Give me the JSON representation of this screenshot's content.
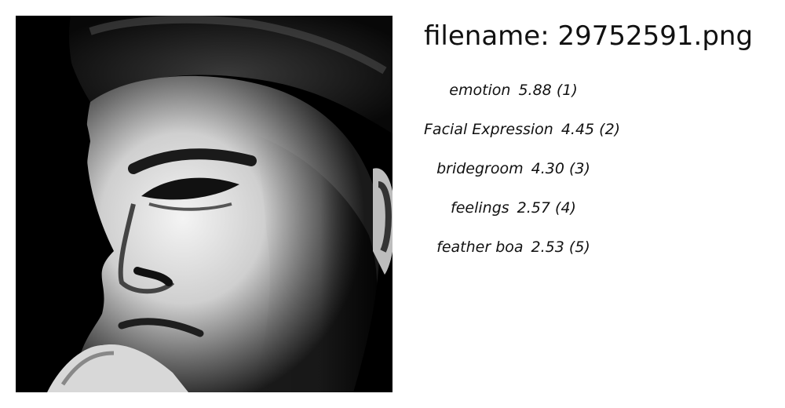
{
  "header": {
    "filename_text": "filename: 29752591.png"
  },
  "image": {
    "icon": "grayscale-face-photo"
  },
  "predictions": [
    {
      "label": "emotion",
      "score": "5.88",
      "rank": "(1)"
    },
    {
      "label": "Facial Expression",
      "score": "4.45",
      "rank": "(2)"
    },
    {
      "label": "bridegroom",
      "score": "4.30",
      "rank": "(3)"
    },
    {
      "label": "feelings",
      "score": "2.57",
      "rank": "(4)"
    },
    {
      "label": "feather boa",
      "score": "2.53",
      "rank": "(5)"
    }
  ]
}
